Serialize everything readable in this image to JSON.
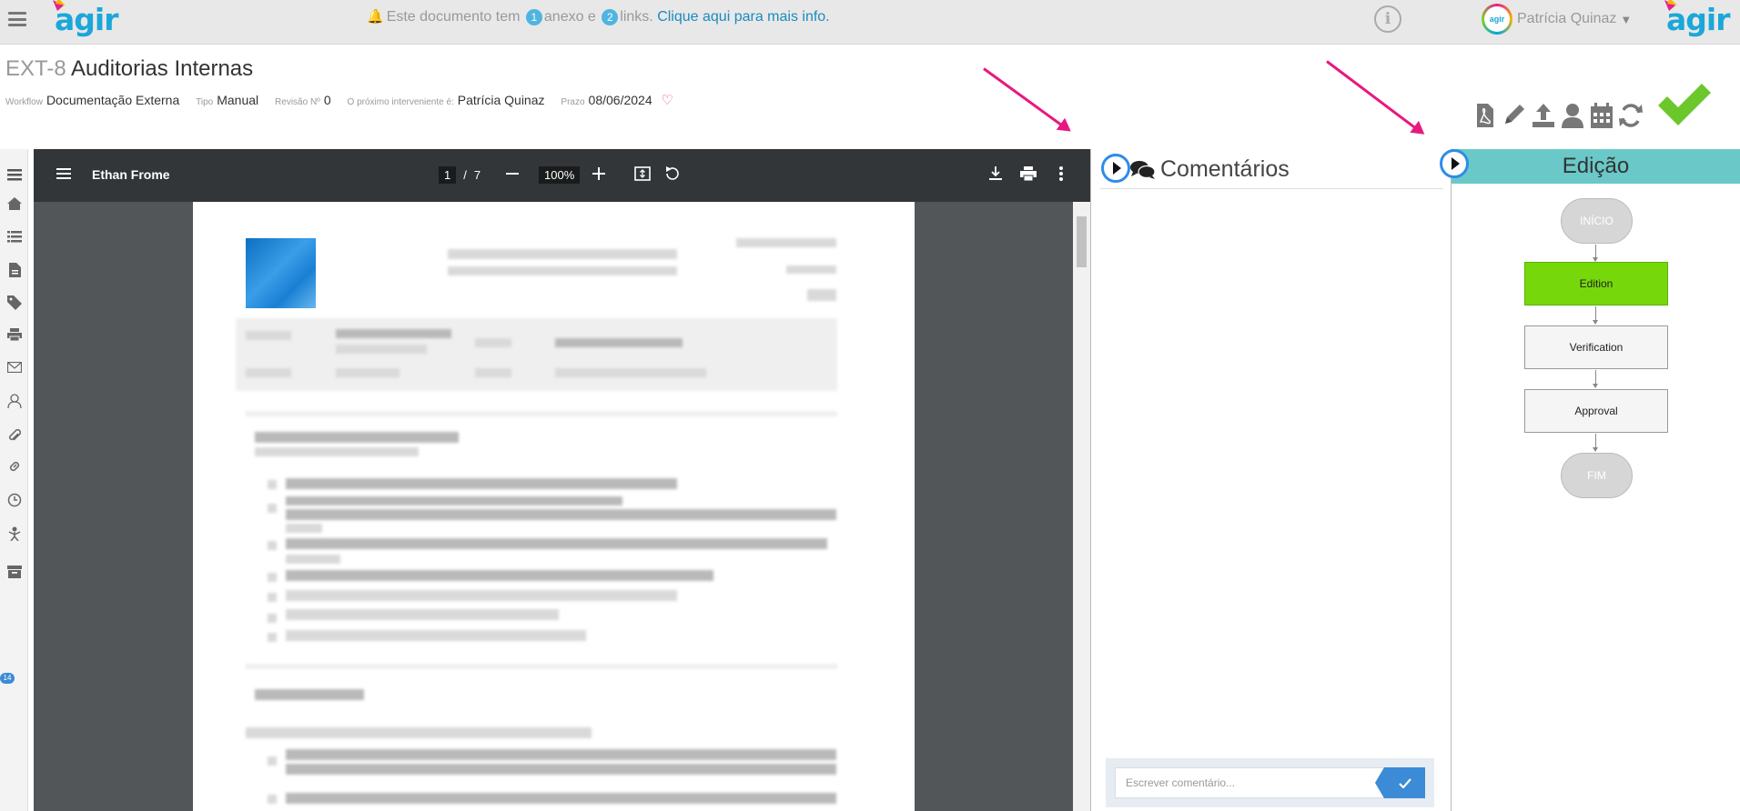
{
  "topbar": {
    "brand_left": "agir",
    "brand_right": "agir",
    "notice": {
      "prefix": "Este documento tem",
      "attachments_count": "1",
      "middle": "anexo e",
      "links_count": "2",
      "suffix": "links.",
      "link_text": "Clique aqui para mais info."
    },
    "user": {
      "avatar_text": "agir",
      "name": "Patrícia Quinaz"
    }
  },
  "document": {
    "code": "EXT-8",
    "title": "Auditorias Internas",
    "meta": [
      {
        "label": "Workflow",
        "value": "Documentação Externa"
      },
      {
        "label": "Tipo",
        "value": "Manual"
      },
      {
        "label": "Revisão Nº",
        "value": "0"
      },
      {
        "label": "O próximo interveniente é:",
        "value": "Patrícia Quinaz"
      },
      {
        "label": "Prazo",
        "value": "08/06/2024"
      }
    ]
  },
  "actions": [
    "pdf-icon",
    "edit-icon",
    "upload-icon",
    "user-icon",
    "calendar-icon",
    "refresh-icon",
    "approve-check-icon"
  ],
  "leftnav": {
    "icons": [
      "menu-icon",
      "home-icon",
      "list-icon",
      "document-icon",
      "tags-icon",
      "print-icon",
      "mail-icon",
      "users-icon",
      "paperclip-icon",
      "link-icon",
      "clock-icon",
      "workflow-icon",
      "archive-icon"
    ],
    "badge": "14"
  },
  "viewer": {
    "file_name": "Ethan Frome",
    "page_current": "1",
    "page_separator": "/",
    "page_total": "7",
    "zoom": "100%"
  },
  "comments": {
    "title": "Comentários",
    "input_placeholder": "Escrever comentário..."
  },
  "edition": {
    "title": "Edição",
    "flow": {
      "start": "INÍCIO",
      "steps": [
        "Edition",
        "Verification",
        "Approval"
      ],
      "current": "Edition",
      "end": "FIM"
    }
  },
  "colors": {
    "accent_blue": "#1ba7d9",
    "current_step_green": "#76d80b",
    "edition_header": "#6ac8c8",
    "annotation_arrow": "#e8197e",
    "approve_check": "#6cc72c"
  }
}
